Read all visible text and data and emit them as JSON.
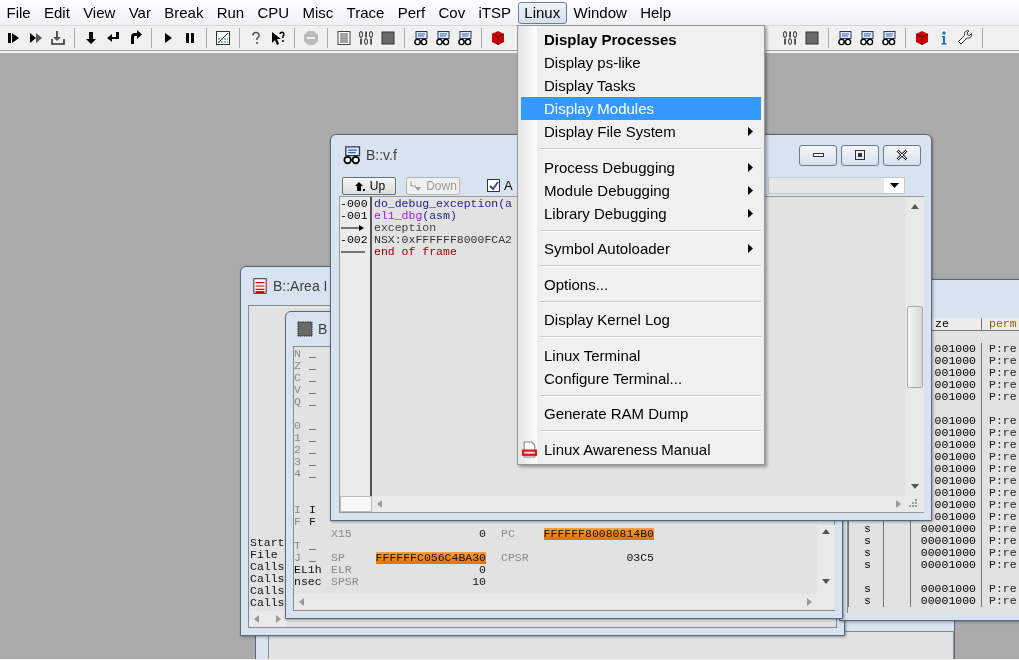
{
  "menu_bar": [
    {
      "label": "File",
      "selected": false
    },
    {
      "label": "Edit",
      "selected": false
    },
    {
      "label": "View",
      "selected": false
    },
    {
      "label": "Var",
      "selected": false
    },
    {
      "label": "Break",
      "selected": false
    },
    {
      "label": "Run",
      "selected": false
    },
    {
      "label": "CPU",
      "selected": false
    },
    {
      "label": "Misc",
      "selected": false
    },
    {
      "label": "Trace",
      "selected": false
    },
    {
      "label": "Perf",
      "selected": false
    },
    {
      "label": "Cov",
      "selected": false
    },
    {
      "label": "iTSP",
      "selected": false
    },
    {
      "label": "Linux",
      "selected": true
    },
    {
      "label": "Window",
      "selected": false
    },
    {
      "label": "Help",
      "selected": false
    }
  ],
  "linux_menu": [
    {
      "kind": "item",
      "label": "Display Processes",
      "bold": true,
      "selected": false,
      "submenu": false
    },
    {
      "kind": "item",
      "label": "Display ps-like",
      "bold": false,
      "selected": false,
      "submenu": false
    },
    {
      "kind": "item",
      "label": "Display Tasks",
      "bold": false,
      "selected": false,
      "submenu": false
    },
    {
      "kind": "item",
      "label": "Display Modules",
      "bold": false,
      "selected": true,
      "submenu": false
    },
    {
      "kind": "item",
      "label": "Display File System",
      "bold": false,
      "selected": false,
      "submenu": true
    },
    {
      "kind": "separator"
    },
    {
      "kind": "item",
      "label": "Process Debugging",
      "bold": false,
      "selected": false,
      "submenu": true
    },
    {
      "kind": "item",
      "label": "Module Debugging",
      "bold": false,
      "selected": false,
      "submenu": true
    },
    {
      "kind": "item",
      "label": "Library Debugging",
      "bold": false,
      "selected": false,
      "submenu": true
    },
    {
      "kind": "separator"
    },
    {
      "kind": "item",
      "label": "Symbol Autoloader",
      "bold": false,
      "selected": false,
      "submenu": true
    },
    {
      "kind": "separator"
    },
    {
      "kind": "item",
      "label": "Options...",
      "bold": false,
      "selected": false,
      "submenu": false
    },
    {
      "kind": "separator"
    },
    {
      "kind": "item",
      "label": "Display Kernel Log",
      "bold": false,
      "selected": false,
      "submenu": false
    },
    {
      "kind": "separator"
    },
    {
      "kind": "item",
      "label": "Linux Terminal",
      "bold": false,
      "selected": false,
      "submenu": false
    },
    {
      "kind": "item",
      "label": "Configure Terminal...",
      "bold": false,
      "selected": false,
      "submenu": false
    },
    {
      "kind": "separator"
    },
    {
      "kind": "item",
      "label": "Generate RAM Dump",
      "bold": false,
      "selected": false,
      "submenu": false
    },
    {
      "kind": "separator"
    },
    {
      "kind": "document",
      "label": "Linux Awareness Manual",
      "bold": false,
      "selected": false,
      "submenu": false
    }
  ],
  "stack_window": {
    "title": "B::v.f",
    "buttons": [
      {
        "label": "Up",
        "disabled": false
      },
      {
        "label": "Down",
        "disabled": true
      }
    ],
    "checkbox": {
      "label": "A",
      "checked": true
    },
    "lines": [
      {
        "kind": "source",
        "index": "-000",
        "name": "do_debug_exception(a"
      },
      {
        "kind": "asm",
        "index": "-001",
        "name": "el1_dbg",
        "args": "(asm)"
      },
      {
        "kind": "exception",
        "name": "exception"
      },
      {
        "kind": "address",
        "index": "-002",
        "name": "NSX:0xFFFFFF8000FCA2"
      },
      {
        "kind": "end",
        "name": "end of frame"
      }
    ]
  },
  "area_window": {
    "title": "B::Area I",
    "lines": [
      "Start",
      "File",
      "Calls",
      "Calls",
      "Calls",
      "Calls"
    ]
  },
  "register_window": {
    "title": "B",
    "rows": [
      {
        "kind": "flag",
        "flag": "N",
        "value": "_"
      },
      {
        "kind": "flag",
        "flag": "Z",
        "value": "_"
      },
      {
        "kind": "flag",
        "flag": "C",
        "value": "_"
      },
      {
        "kind": "flag",
        "flag": "V",
        "value": "_"
      },
      {
        "kind": "flag",
        "flag": "Q",
        "value": "_"
      },
      {
        "kind": "blank"
      },
      {
        "kind": "flag",
        "flag": "0",
        "value": "_"
      },
      {
        "kind": "flag",
        "flag": "1",
        "value": "_"
      },
      {
        "kind": "flag",
        "flag": "2",
        "value": "_"
      },
      {
        "kind": "flag",
        "flag": "3",
        "value": "_"
      },
      {
        "kind": "flag",
        "flag": "4",
        "value": "_"
      },
      {
        "kind": "blank"
      },
      {
        "kind": "blank"
      },
      {
        "kind": "flag",
        "flag": "I",
        "value": "I"
      },
      {
        "kind": "flag",
        "flag": "F",
        "value": "F"
      },
      {
        "kind": "registers",
        "registers": [
          {
            "name": "X15",
            "value": "0",
            "changed": false
          },
          {
            "name": "PC",
            "value": "FFFFFF80080814B0",
            "changed": true
          }
        ]
      },
      {
        "kind": "flag",
        "flag": "T",
        "value": "_"
      },
      {
        "kind": "flag",
        "flag": "J",
        "value": "_",
        "registers": [
          {
            "name": "SP",
            "value": "FFFFFFC056C4BA30",
            "changed": true
          },
          {
            "name": "CPSR",
            "value": "03C5",
            "changed": false
          }
        ]
      },
      {
        "kind": "flag",
        "flag": "EL1h",
        "registers": [
          {
            "name": "ELR",
            "value": "0",
            "changed": false
          }
        ]
      },
      {
        "kind": "flag",
        "flag": "nsec",
        "registers": [
          {
            "name": "SPSR",
            "value": "10",
            "changed": false
          }
        ]
      }
    ]
  },
  "modules_window": {
    "columns": [
      "ze",
      "perm"
    ],
    "rows": [
      {
        "kind": "row",
        "size": "001000",
        "permissions": "P:re"
      },
      {
        "kind": "row",
        "size": "001000",
        "permissions": "P:re"
      },
      {
        "kind": "row",
        "size": "001000",
        "permissions": "P:re"
      },
      {
        "kind": "row",
        "size": "001000",
        "permissions": "P:re"
      },
      {
        "kind": "row",
        "size": "001000",
        "permissions": "P:re"
      },
      {
        "kind": "blank"
      },
      {
        "kind": "row",
        "size": "001000",
        "permissions": "P:re"
      },
      {
        "kind": "row",
        "size": "001000",
        "permissions": "P:re"
      },
      {
        "kind": "row",
        "size": "001000",
        "permissions": "P:re"
      },
      {
        "kind": "row",
        "size": "001000",
        "permissions": "P:re"
      },
      {
        "kind": "row",
        "size": "001000",
        "permissions": "P:re"
      },
      {
        "kind": "row",
        "size": "001000",
        "permissions": "P:re"
      },
      {
        "kind": "row",
        "size": "001000",
        "permissions": "P:re"
      },
      {
        "kind": "row",
        "size": "001000",
        "permissions": "P:re"
      },
      {
        "kind": "row",
        "size": "001000",
        "permissions": "P:re"
      },
      {
        "kind": "row",
        "type": "s",
        "size": "00001000",
        "permissions": "P:re"
      },
      {
        "kind": "row",
        "type": "s",
        "size": "00001000",
        "permissions": "P:re"
      },
      {
        "kind": "row",
        "type": "s",
        "size": "00001000",
        "permissions": "P:re"
      },
      {
        "kind": "row",
        "type": "s",
        "size": "00001000",
        "permissions": "P:re"
      },
      {
        "kind": "blank"
      },
      {
        "kind": "row",
        "type": "s",
        "size": "00001000",
        "permissions": "P:re"
      },
      {
        "kind": "row",
        "type": "s",
        "size": "00001000",
        "permissions": "P:re"
      }
    ]
  }
}
